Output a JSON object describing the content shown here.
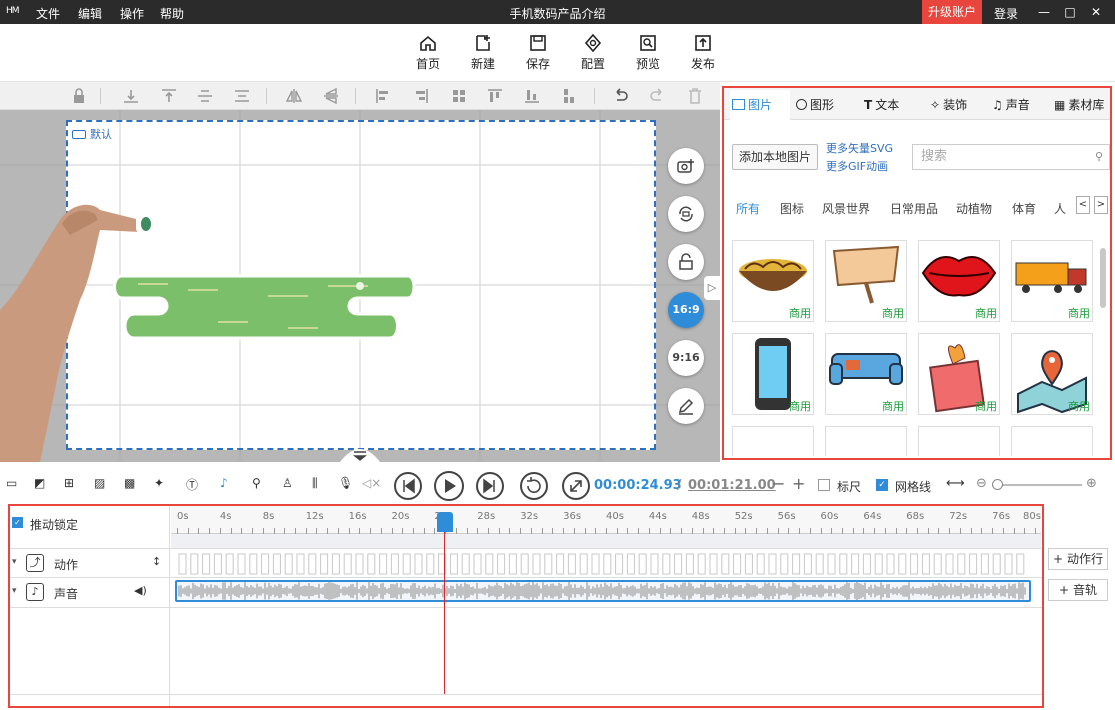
{
  "titlebar": {
    "logo": "HM",
    "menu": [
      "文件",
      "编辑",
      "操作",
      "帮助"
    ],
    "title": "手机数码产品介绍",
    "upgrade": "升级账户",
    "login": "登录"
  },
  "toolbar": {
    "items": [
      "首页",
      "新建",
      "保存",
      "配置",
      "预览",
      "发布"
    ]
  },
  "canvas": {
    "default_label": "默认"
  },
  "side": {
    "ratio_169": "16:9",
    "ratio_916": "9:16"
  },
  "panel": {
    "tabs": [
      "图片",
      "图形",
      "文本",
      "装饰",
      "声音",
      "素材库"
    ],
    "add_local": "添加本地图片",
    "more_svg": "更多矢量SVG",
    "more_gif": "更多GIF动画",
    "search_placeholder": "搜索",
    "categories": [
      "所有",
      "图标",
      "风景世界",
      "日常用品",
      "动植物",
      "体育",
      "人"
    ],
    "commercial_tag": "商用"
  },
  "controls": {
    "current_time": "00:00:24.93",
    "separator": "/",
    "total_time": "00:01:21.00",
    "ruler_label": "标尺",
    "grid_label": "网格线",
    "ruler_checked": false,
    "grid_checked": true
  },
  "timeline": {
    "lock_label": "推动锁定",
    "action_label": "动作",
    "sound_label": "声音",
    "add_action": "动作行",
    "add_track": "音轨",
    "ticks": [
      "0s",
      "4s",
      "8s",
      "12s",
      "16s",
      "20s",
      "24s",
      "28s",
      "32s",
      "36s",
      "40s",
      "44s",
      "48s",
      "52s",
      "56s",
      "60s",
      "64s",
      "68s",
      "72s",
      "76s",
      "80s"
    ],
    "playhead_seconds": 24.93,
    "ruler_max_seconds": 80
  },
  "colors": {
    "accent": "#2f8cd8",
    "highlight_border": "#e8453c",
    "upgrade_bg": "#e8453c",
    "playhead": "#d62828",
    "tag_green": "#1a9b3a"
  }
}
